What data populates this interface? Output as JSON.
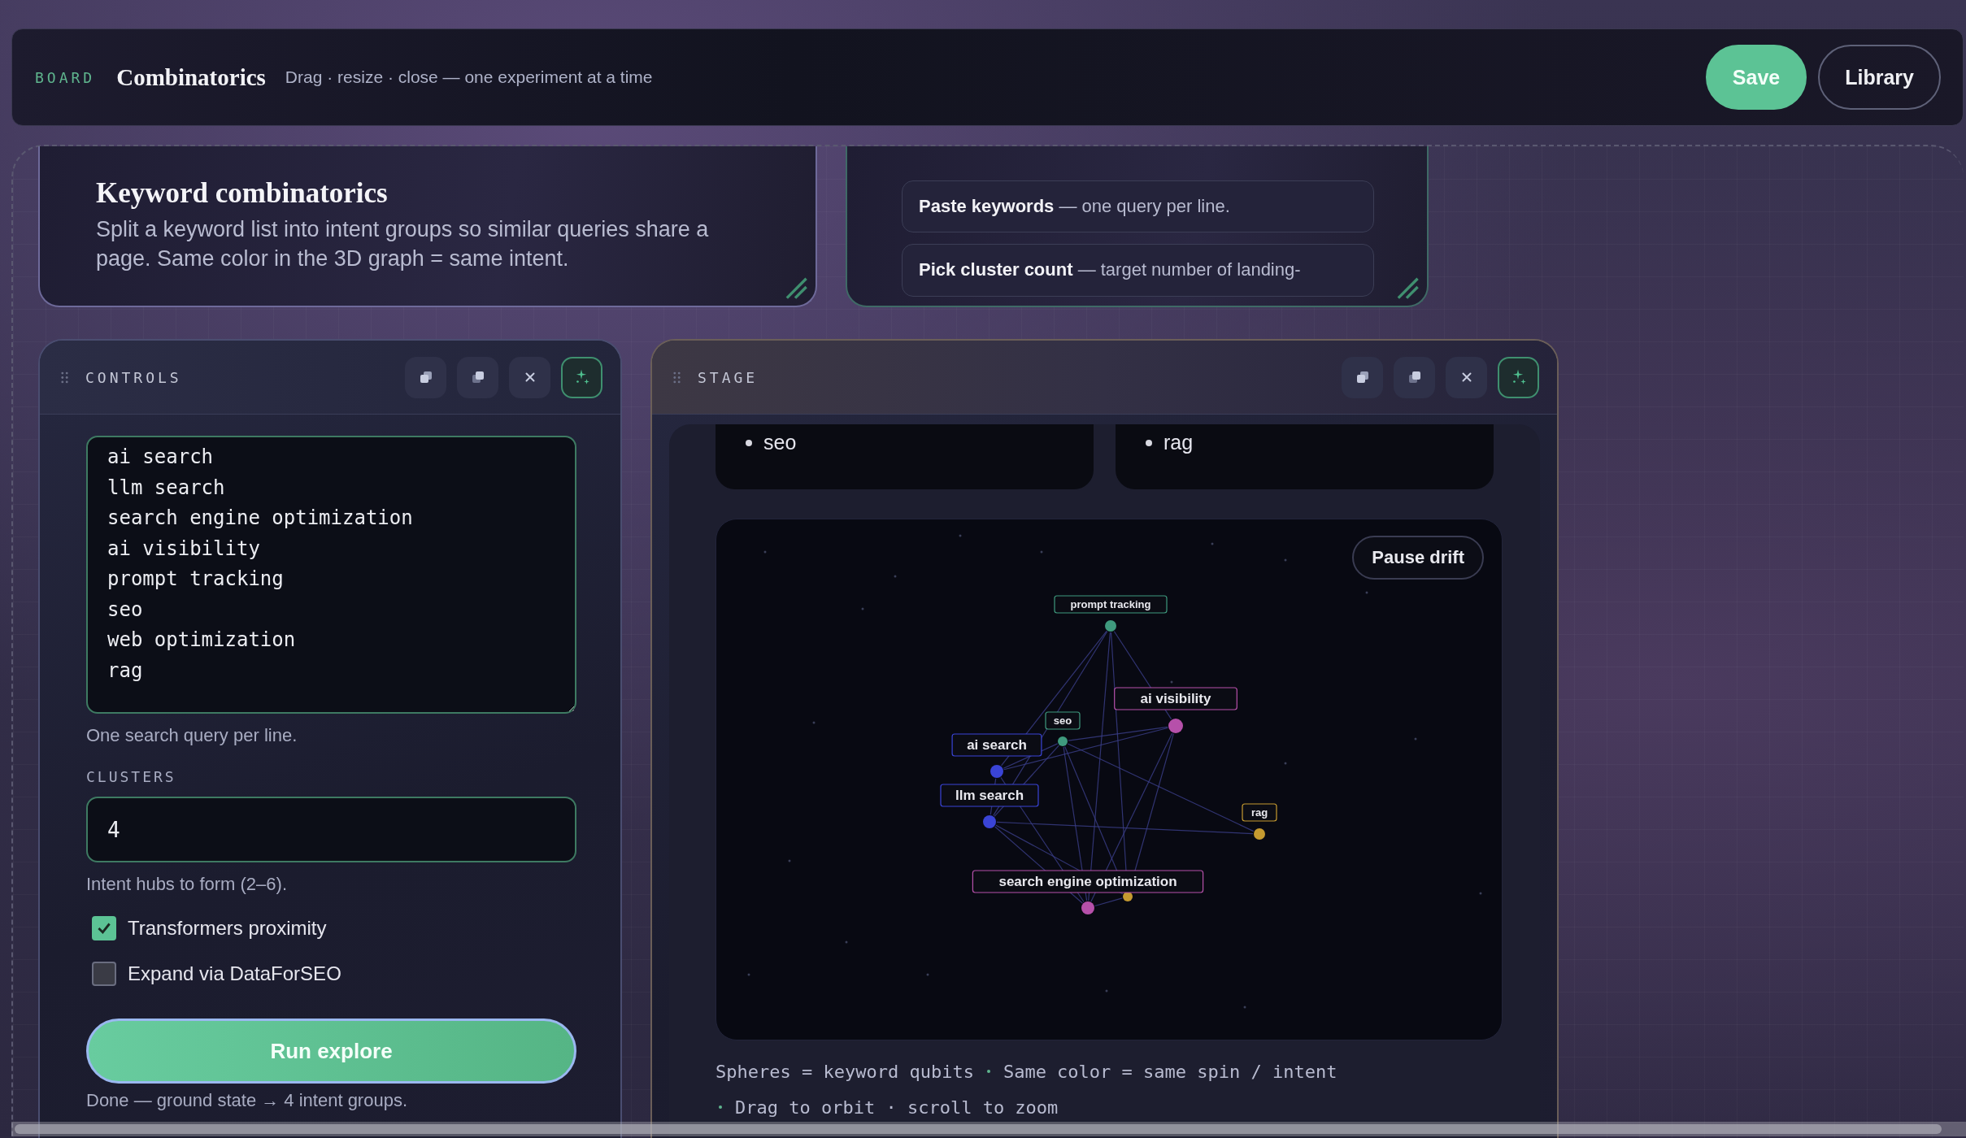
{
  "header": {
    "eyebrow": "BOARD",
    "title": "Combinatorics",
    "subtitle": "Drag · resize · close — one experiment at a time",
    "buttons": [
      {
        "label": "Save",
        "kind": "primary"
      },
      {
        "label": "Library",
        "kind": "outline"
      }
    ]
  },
  "intro": {
    "title": "Keyword combinatorics",
    "text": "Split a keyword list into intent groups so similar queries share a page. Same color in the 3D graph = same intent."
  },
  "steps": [
    "**Paste keywords** — one query per line.",
    "**Pick cluster count** — target number of landing-"
  ],
  "controls": {
    "title": "CONTROLS",
    "keywords": "ai search\nllm search\nsearch engine optimization\nai visibility\nprompt tracking\nseo\nweb optimization\nrag",
    "keywords_hint": "One search query per line.",
    "clusters_label": "CLUSTERS",
    "clusters_value": "4",
    "clusters_hint": "Intent hubs to form (2–6).",
    "options": [
      {
        "label": "Transformers proximity",
        "checked": true
      },
      {
        "label": "Expand via DataForSEO",
        "checked": false
      }
    ],
    "run_button": "Run explore",
    "status": "Done — ground state → 4 intent groups."
  },
  "stage": {
    "title": "STAGE",
    "groups": [
      {
        "items": [
          "seo"
        ]
      },
      {
        "items": [
          "rag"
        ]
      }
    ],
    "pause_button": "Pause drift",
    "nodes": [
      {
        "label": "prompt tracking",
        "color": "#3f9a7e"
      },
      {
        "label": "ai visibility",
        "color": "#b650aa"
      },
      {
        "label": "seo",
        "color": "#3f9a7e"
      },
      {
        "label": "ai search",
        "color": "#3a44d6"
      },
      {
        "label": "llm search",
        "color": "#3a44d6"
      },
      {
        "label": "rag",
        "color": "#c59a30"
      },
      {
        "color": "#c59a30"
      },
      {
        "label": "search engine optimization",
        "color": "#b650aa"
      }
    ],
    "captions": [
      [
        "Spheres = keyword qubits",
        "Same color = same spin / intent"
      ],
      [
        "Drag to orbit · scroll to zoom"
      ]
    ]
  }
}
